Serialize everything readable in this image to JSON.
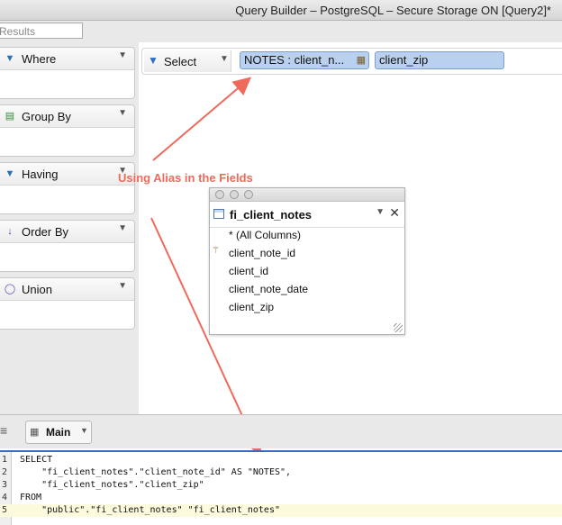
{
  "window": {
    "title": "Query Builder – PostgreSQL – Secure Storage ON [Query2]*"
  },
  "search": {
    "placeholder": "Results"
  },
  "clause_panels": [
    {
      "label": "Where"
    },
    {
      "label": "Group By"
    },
    {
      "label": "Having"
    },
    {
      "label": "Order By"
    },
    {
      "label": "Union"
    }
  ],
  "select_bar": {
    "label": "Select",
    "fields": [
      "NOTES : client_n...",
      "client_zip"
    ]
  },
  "annotation": "Using Alias in the Fields",
  "table_window": {
    "name": "fi_client_notes",
    "columns": [
      "* (All Columns)",
      "client_note_id",
      "client_id",
      "client_note_date",
      "client_zip"
    ]
  },
  "bottom": {
    "tab_label": "Main"
  },
  "sql": {
    "lines": [
      {
        "num": "1",
        "text": "SELECT"
      },
      {
        "num": "2",
        "text": "    \"fi_client_notes\".\"client_note_id\" AS \"NOTES\","
      },
      {
        "num": "3",
        "text": "    \"fi_client_notes\".\"client_zip\""
      },
      {
        "num": "4",
        "text": "FROM"
      },
      {
        "num": "5",
        "text": "    \"public\".\"fi_client_notes\" \"fi_client_notes\""
      }
    ]
  },
  "colors": {
    "annotation": "#ef6a5b",
    "field_bg": "#b9d1ef",
    "editor_accent": "#3a68c4"
  }
}
